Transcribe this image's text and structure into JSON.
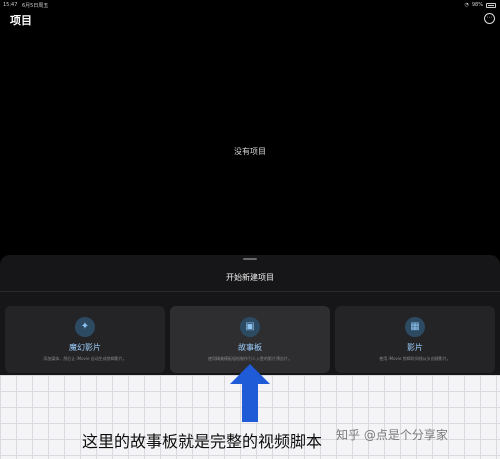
{
  "status_bar": {
    "time": "15:47",
    "date": "6月5日周五",
    "battery": "98%",
    "wifi_icon": "wifi-icon"
  },
  "header": {
    "title": "项目",
    "more_icon": "⋯"
  },
  "main": {
    "empty_text": "没有项目"
  },
  "sheet": {
    "title": "开始新建项目",
    "cards": [
      {
        "icon": "✦",
        "icon_name": "magic-wand-icon",
        "label": "魔幻影片",
        "desc": "添加媒体，然后让 iMovie 自动生成剪辑影片。"
      },
      {
        "icon": "▣",
        "icon_name": "storyboard-icon",
        "label": "故事板",
        "desc": "使用精美模板轻松制作引人入胜的影片预告片。"
      },
      {
        "icon": "▦",
        "icon_name": "film-icon",
        "label": "影片",
        "desc": "使用 iMovie 剪辑时间线从头创建影片。"
      }
    ]
  },
  "annotation": {
    "caption": "这里的故事板就是完整的视频脚本",
    "watermark": "知乎 @点是个分享家",
    "arrow_color": "#1f5bd6"
  }
}
